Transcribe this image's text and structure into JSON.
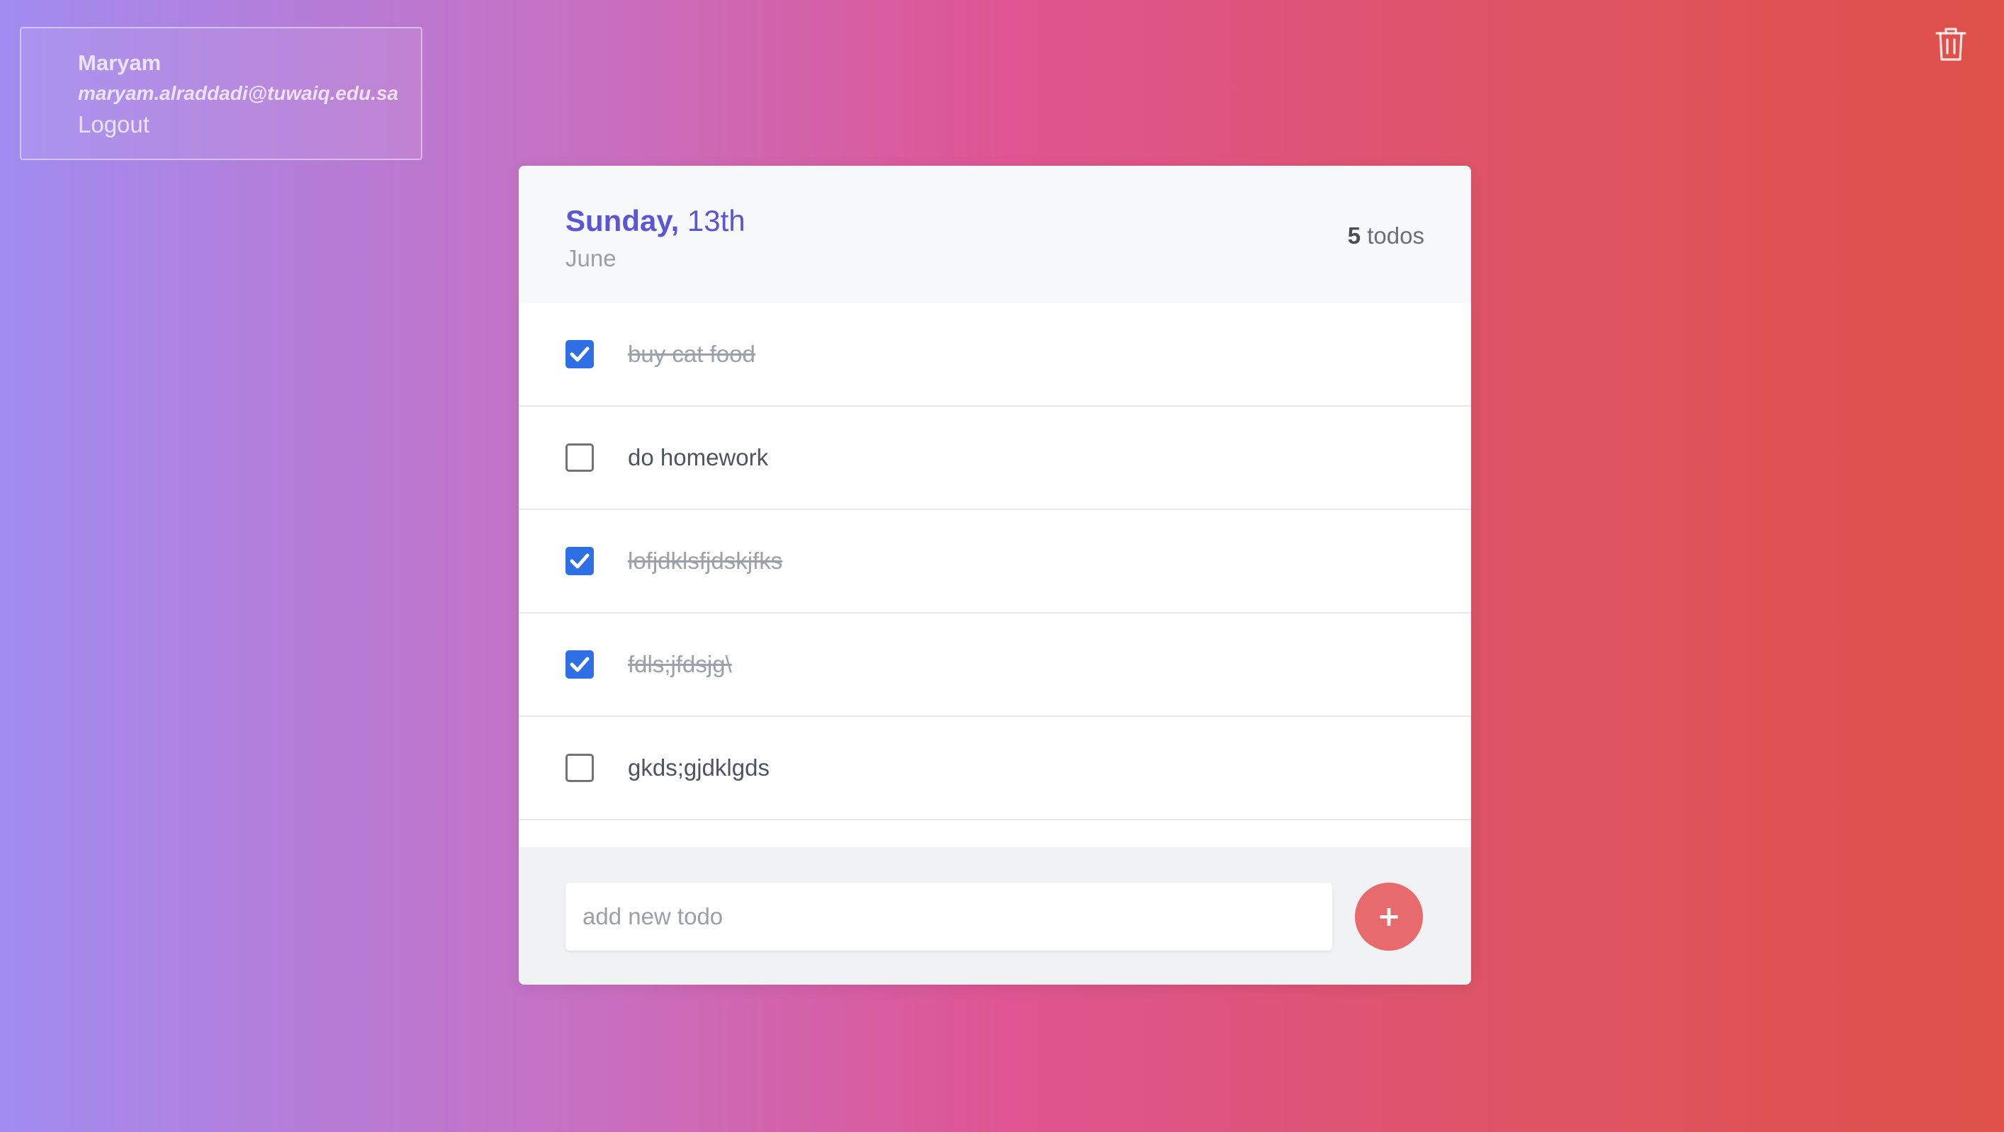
{
  "user": {
    "name": "Maryam",
    "email": "maryam.alraddadi@tuwaiq.edu.sa",
    "logout_label": "Logout"
  },
  "toolbar": {
    "trash_icon": "trash-icon"
  },
  "header": {
    "day": "Sunday,",
    "date": "13th",
    "month": "June",
    "count": "5",
    "count_label": "todos"
  },
  "todos": [
    {
      "text": "buy cat food",
      "done": true
    },
    {
      "text": "do homework",
      "done": false
    },
    {
      "text": "lofjdklsfjdskjfks",
      "done": true
    },
    {
      "text": "fdls;jfdsjg\\",
      "done": true
    },
    {
      "text": "gkds;gjdklgds",
      "done": false
    }
  ],
  "footer": {
    "input_value": "",
    "input_placeholder": "add new todo",
    "add_label": "+"
  },
  "colors": {
    "accent": "#5b56d6",
    "checkbox_checked": "#2f6fe4",
    "add_button": "#e76a6c",
    "gradient_start": "#a18cf0",
    "gradient_end": "#de5048"
  }
}
